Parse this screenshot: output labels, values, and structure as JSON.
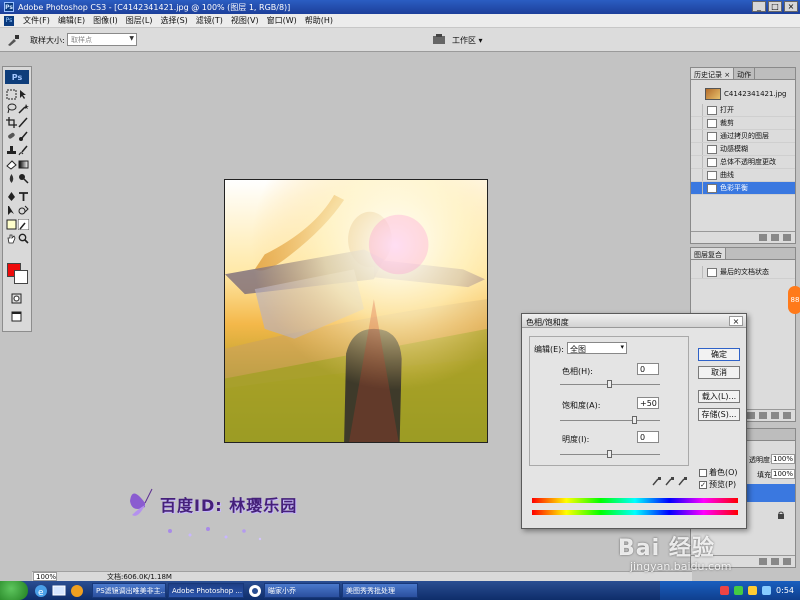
{
  "window": {
    "title": "Adobe Photoshop CS3 - [C4142341421.jpg @ 100% (图层 1, RGB/8)]",
    "min": "_",
    "max": "□",
    "close": "×"
  },
  "menu": {
    "items": [
      "文件(F)",
      "编辑(E)",
      "图像(I)",
      "图层(L)",
      "选择(S)",
      "滤镜(T)",
      "视图(V)",
      "窗口(W)",
      "帮助(H)"
    ]
  },
  "options_bar": {
    "sample_label": "取样大小:",
    "sample_value": "取样点",
    "workspace_label": "工作区 ▾"
  },
  "toolbox": {
    "logo": "Ps"
  },
  "history_panel": {
    "tabs": [
      "历史记录 ×",
      "动作"
    ],
    "snapshot": "C4142341421.jpg",
    "items": [
      {
        "label": "打开"
      },
      {
        "label": "裁剪"
      },
      {
        "label": "通过拷贝的图层"
      },
      {
        "label": "动感模糊"
      },
      {
        "label": "总体不透明度更改"
      },
      {
        "label": "曲线"
      },
      {
        "label": "色彩平衡"
      }
    ]
  },
  "info_panel": {
    "tab": "图层复合",
    "row": "最后的文档状态"
  },
  "layers_panel": {
    "opacity_label": "透明度:",
    "opacity_value": "100%",
    "fill_label": "填充:",
    "fill_value": "100%"
  },
  "dialog": {
    "title": "色相/饱和度",
    "close": "×",
    "edit_label": "编辑(E):",
    "edit_value": "全图",
    "hue_label": "色相(H):",
    "hue_value": "0",
    "hue_level": 0.5,
    "saturation_label": "饱和度(A):",
    "saturation_value": "+50",
    "saturation_level": 0.75,
    "lightness_label": "明度(I):",
    "lightness_value": "0",
    "lightness_level": 0.5,
    "ok": "确定",
    "cancel": "取消",
    "load": "载入(L)...",
    "save": "存储(S)...",
    "colorize": "着色(O)",
    "preview": "预览(P)",
    "preview_checked": "✓"
  },
  "watermark": {
    "text": "百度ID: 林璎乐园"
  },
  "status": {
    "zoom": "100%",
    "doc": "文档:606.0K/1.18M"
  },
  "taskbar": {
    "buttons": [
      {
        "label": "PS滤镜调出唯美非主..."
      },
      {
        "label": "Adobe Photoshop ..."
      },
      {
        "label": "瞄家小乔"
      },
      {
        "label": "美图秀秀批处理"
      }
    ],
    "clock": "0:54"
  },
  "baidu": {
    "brand": "Bai 经验",
    "url": "jingyan.baidu.com"
  },
  "edge_badge": "88"
}
